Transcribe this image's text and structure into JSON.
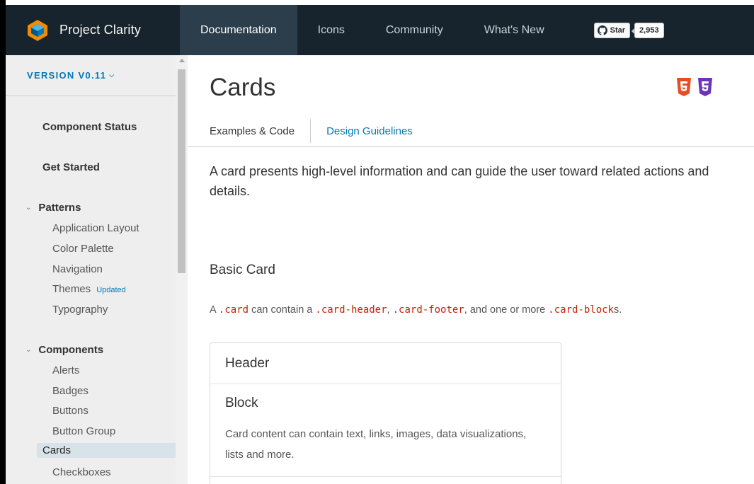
{
  "header": {
    "brand": "Project Clarity",
    "nav": [
      {
        "label": "Documentation",
        "active": true
      },
      {
        "label": "Icons",
        "active": false
      },
      {
        "label": "Community",
        "active": false
      },
      {
        "label": "What's New",
        "active": false
      }
    ],
    "github": {
      "star_label": "Star",
      "count": "2,953"
    },
    "colors": {
      "bg": "#17242d",
      "active": "#2c3e4c",
      "logo_blue": "#0079b8",
      "logo_orange": "#f38b00"
    }
  },
  "sidebar": {
    "version": "VERSION V0.11",
    "links": [
      "Component Status",
      "Get Started"
    ],
    "patterns": {
      "label": "Patterns",
      "items": [
        "Application Layout",
        "Color Palette",
        "Navigation",
        "Themes",
        "Typography"
      ],
      "themes_badge": "Updated"
    },
    "components": {
      "label": "Components",
      "items": [
        "Alerts",
        "Badges",
        "Buttons",
        "Button Group",
        "Cards",
        "Checkboxes"
      ],
      "active": "Cards"
    }
  },
  "main": {
    "title": "Cards",
    "tech_icons": [
      "html5-icon",
      "css3-icon"
    ],
    "tabs": [
      "Examples & Code",
      "Design Guidelines"
    ],
    "intro": "A card presents high-level information and can guide the user toward related actions and details.",
    "basic_card": {
      "heading": "Basic Card",
      "desc": {
        "a": "A ",
        "card": ".card",
        "mid1": " can contain a ",
        "card_header": ".card-header",
        "comma": ", ",
        "card_footer": ".card-footer",
        "mid2": ", and one or more ",
        "card_block": ".card-block",
        "end": "s."
      },
      "card": {
        "header": "Header",
        "block_title": "Block",
        "block_text": "Card content can contain text, links, images, data visualizations, lists and more."
      }
    }
  }
}
